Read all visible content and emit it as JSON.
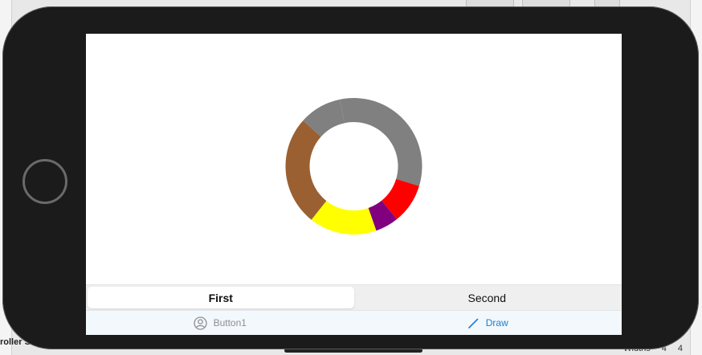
{
  "background": {
    "bottom_left_text": "roller Sc",
    "bottom_right_items": [
      "Widths",
      "4",
      "4"
    ]
  },
  "chart_data": {
    "type": "pie",
    "variant": "donut",
    "title": "",
    "slices": [
      {
        "color": "#808080",
        "value": 0.33
      },
      {
        "color": "#ff0000",
        "value": 0.095
      },
      {
        "color": "#800080",
        "value": 0.055
      },
      {
        "color": "#ffff00",
        "value": 0.16
      },
      {
        "color": "#9a6031",
        "value": 0.26
      },
      {
        "color": "#808080",
        "value": 0.1
      }
    ],
    "start_angle_deg": -102
  },
  "segmented": {
    "items": [
      {
        "label": "First",
        "selected": true
      },
      {
        "label": "Second",
        "selected": false
      }
    ]
  },
  "toolbar": {
    "button1": {
      "label": "Button1",
      "icon": "person-circle-icon",
      "enabled": false
    },
    "draw": {
      "label": "Draw",
      "icon": "pencil-icon",
      "enabled": true,
      "color": "#1a7ed9"
    }
  }
}
